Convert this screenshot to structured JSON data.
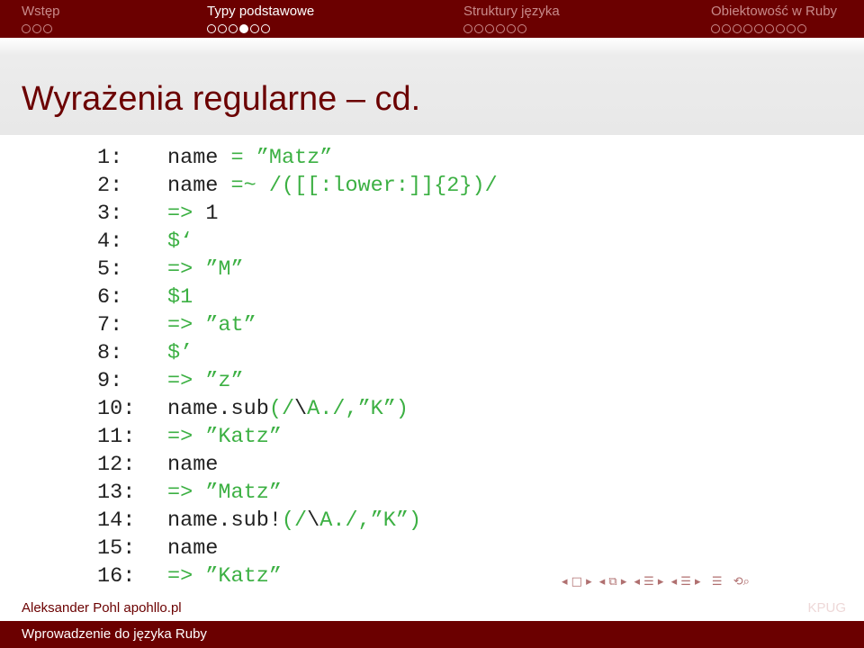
{
  "nav": {
    "sections": [
      {
        "label": "Wstęp",
        "dots": 3,
        "current": -1,
        "active": false
      },
      {
        "label": "Typy podstawowe",
        "dots": 6,
        "current": 3,
        "active": true
      },
      {
        "label": "Struktury języka",
        "dots": 6,
        "current": -1,
        "active": false
      },
      {
        "label": "Obiektowość w Ruby",
        "dots": 9,
        "current": -1,
        "active": false
      }
    ]
  },
  "frame": {
    "title": "Wyrażenia regularne – cd."
  },
  "code": {
    "lines": [
      {
        "num": "1:",
        "parts": [
          [
            "kw",
            "name "
          ],
          [
            "op",
            "= "
          ],
          [
            "str",
            "”Matz”"
          ]
        ]
      },
      {
        "num": "2:",
        "parts": [
          [
            "kw",
            "name "
          ],
          [
            "op",
            "=~ "
          ],
          [
            "str",
            "/([[:lower:]]{2})/"
          ]
        ]
      },
      {
        "num": "3:",
        "parts": [
          [
            "op",
            "=> "
          ],
          [
            "kw",
            "1"
          ]
        ]
      },
      {
        "num": "4:",
        "parts": [
          [
            "str",
            "$‘"
          ]
        ]
      },
      {
        "num": "5:",
        "parts": [
          [
            "op",
            "=> "
          ],
          [
            "str",
            "”M”"
          ]
        ]
      },
      {
        "num": "6:",
        "parts": [
          [
            "str",
            "$1"
          ]
        ]
      },
      {
        "num": "7:",
        "parts": [
          [
            "op",
            "=> "
          ],
          [
            "str",
            "”at”"
          ]
        ]
      },
      {
        "num": "8:",
        "parts": [
          [
            "str",
            "$’"
          ]
        ]
      },
      {
        "num": "9:",
        "parts": [
          [
            "op",
            "=> "
          ],
          [
            "str",
            "”z”"
          ]
        ]
      },
      {
        "num": "10:",
        "parts": [
          [
            "kw",
            "name.sub"
          ],
          [
            "op",
            "("
          ],
          [
            "str",
            "/"
          ],
          [
            "kw",
            "\\"
          ],
          [
            "str",
            "A./"
          ],
          [
            "op",
            ","
          ],
          [
            "str",
            "”K”"
          ],
          [
            "op",
            ")"
          ]
        ]
      },
      {
        "num": "11:",
        "parts": [
          [
            "op",
            "=> "
          ],
          [
            "str",
            "”Katz”"
          ]
        ]
      },
      {
        "num": "12:",
        "parts": [
          [
            "kw",
            "name"
          ]
        ]
      },
      {
        "num": "13:",
        "parts": [
          [
            "op",
            "=> "
          ],
          [
            "str",
            "”Matz”"
          ]
        ]
      },
      {
        "num": "14:",
        "parts": [
          [
            "kw",
            "name.sub!"
          ],
          [
            "op",
            "("
          ],
          [
            "str",
            "/"
          ],
          [
            "kw",
            "\\"
          ],
          [
            "str",
            "A./"
          ],
          [
            "op",
            ","
          ],
          [
            "str",
            "”K”"
          ],
          [
            "op",
            ")"
          ]
        ]
      },
      {
        "num": "15:",
        "parts": [
          [
            "kw",
            "name"
          ]
        ]
      },
      {
        "num": "16:",
        "parts": [
          [
            "op",
            "=> "
          ],
          [
            "str",
            "”Katz”"
          ]
        ]
      }
    ]
  },
  "footer": {
    "author": "Aleksander Pohl apohllo.pl",
    "title": "Wprowadzenie do języka Ruby",
    "logo_text": "KPUG"
  },
  "colors": {
    "brand": "#6b0000",
    "code_green": "#3cb043"
  }
}
